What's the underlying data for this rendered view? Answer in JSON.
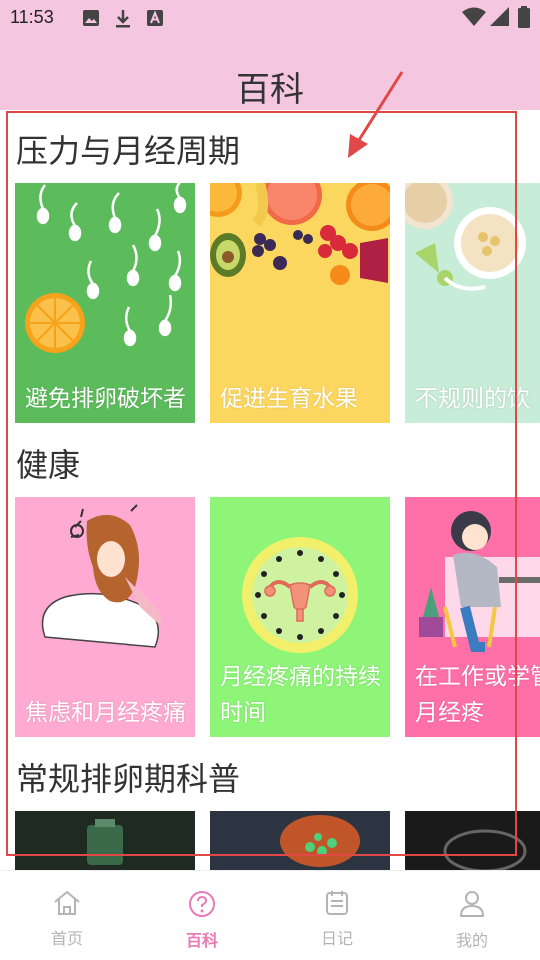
{
  "status_bar": {
    "time": "11:53"
  },
  "header": {
    "title": "百科"
  },
  "sections": [
    {
      "title": "压力与月经周期",
      "cards": [
        {
          "caption": "避免排卵破坏者"
        },
        {
          "caption": "促进生育水果"
        },
        {
          "caption": "不规则的饮"
        }
      ]
    },
    {
      "title": "健康",
      "cards": [
        {
          "caption": "焦虑和月经疼痛"
        },
        {
          "caption": "月经疼痛的持续时间"
        },
        {
          "caption": "在工作或学管理月经疼"
        }
      ]
    },
    {
      "title": "常规排卵期科普",
      "cards": []
    }
  ],
  "bottom_nav": {
    "tabs": [
      {
        "label": "首页",
        "icon": "home-icon"
      },
      {
        "label": "百科",
        "icon": "question-circle-icon",
        "active": true
      },
      {
        "label": "日记",
        "icon": "notebook-icon"
      },
      {
        "label": "我的",
        "icon": "person-icon"
      }
    ]
  },
  "colors": {
    "header_bg": "#f4c6df",
    "active_tab": "#e97ab6",
    "inactive_tab": "#b4b4b4",
    "highlight": "#e04848"
  }
}
